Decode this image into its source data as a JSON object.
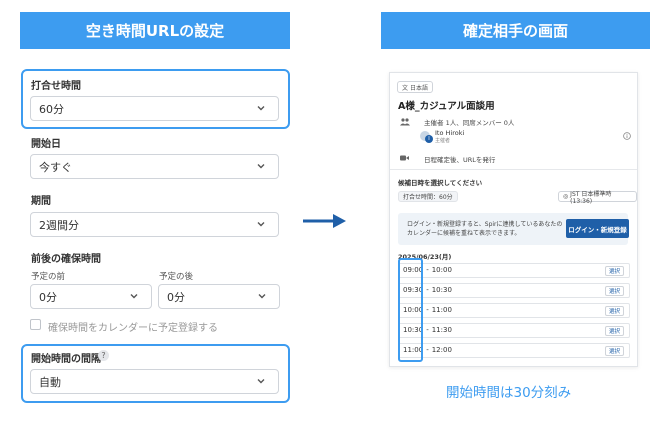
{
  "left_panel": {
    "banner": "空き時間URLの設定",
    "meeting_duration": {
      "label": "打合せ時間",
      "value": "60分"
    },
    "start_date": {
      "label": "開始日",
      "value": "今すぐ"
    },
    "period": {
      "label": "期間",
      "value": "2週間分"
    },
    "buffer": {
      "label": "前後の確保時間",
      "before": {
        "label": "予定の前",
        "value": "0分"
      },
      "after": {
        "label": "予定の後",
        "value": "0分"
      }
    },
    "buffer_checkbox_label": "確保時間をカレンダーに予定登録する",
    "start_interval": {
      "label": "開始時間の間隔",
      "help": "?",
      "value": "自動"
    }
  },
  "right_panel": {
    "banner": "確定相手の画面",
    "language": "日本語",
    "title": "A様_カジュアル面談用",
    "participants": "主催者 1人、同席メンバー 0人",
    "host_name": "Ito Hiroki",
    "host_role": "主催者",
    "host_initial": "I",
    "video_note": "日程確定後、URLを発行",
    "select_prompt": "候補日時を選択してください",
    "duration_chip": "打合せ時間：60分",
    "timezone_chip": "JST 日本標準時(13:36)",
    "notice_line1": "ログイン・新規登録すると、Spirに連携しているあなたの",
    "notice_line2": "カレンダーに候補を重ねて表示できます。",
    "login_button": "ログイン・新規登録",
    "date": "2025/06/23(月)",
    "slot_separator": "-",
    "select_label": "選択",
    "slots": [
      {
        "start": "09:00",
        "end": "10:00"
      },
      {
        "start": "09:30",
        "end": "10:30"
      },
      {
        "start": "10:00",
        "end": "11:00"
      },
      {
        "start": "10:30",
        "end": "11:30"
      },
      {
        "start": "11:00",
        "end": "12:00"
      }
    ]
  },
  "caption": "開始時間は30分刻み",
  "colors": {
    "accent": "#3d9cf0",
    "button": "#1f5fa8"
  }
}
